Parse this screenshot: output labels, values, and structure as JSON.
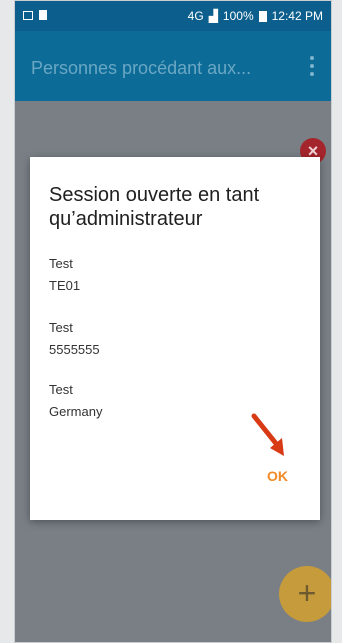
{
  "status_bar": {
    "network": "4G",
    "signal": "",
    "battery_percent": "100%",
    "time": "12:42 PM"
  },
  "app_bar": {
    "title": "Personnes procédant aux...",
    "menu_icon": "more-vert-icon"
  },
  "dialog": {
    "title": "Session ouverte en tant qu’administrateur",
    "entries": [
      {
        "label": "Test",
        "value": "TE01"
      },
      {
        "label": "Test",
        "value": "5555555"
      },
      {
        "label": "Test",
        "value": "Germany"
      }
    ],
    "ok_label": "OK"
  },
  "fabs": {
    "close_label": "×",
    "add_label": "+"
  },
  "colors": {
    "app_bar": "#0d6c97",
    "status_bar": "#0c5f8c",
    "accent": "#f18a26",
    "add_fab": "#c69b3b",
    "close_fab": "#a5252c"
  }
}
